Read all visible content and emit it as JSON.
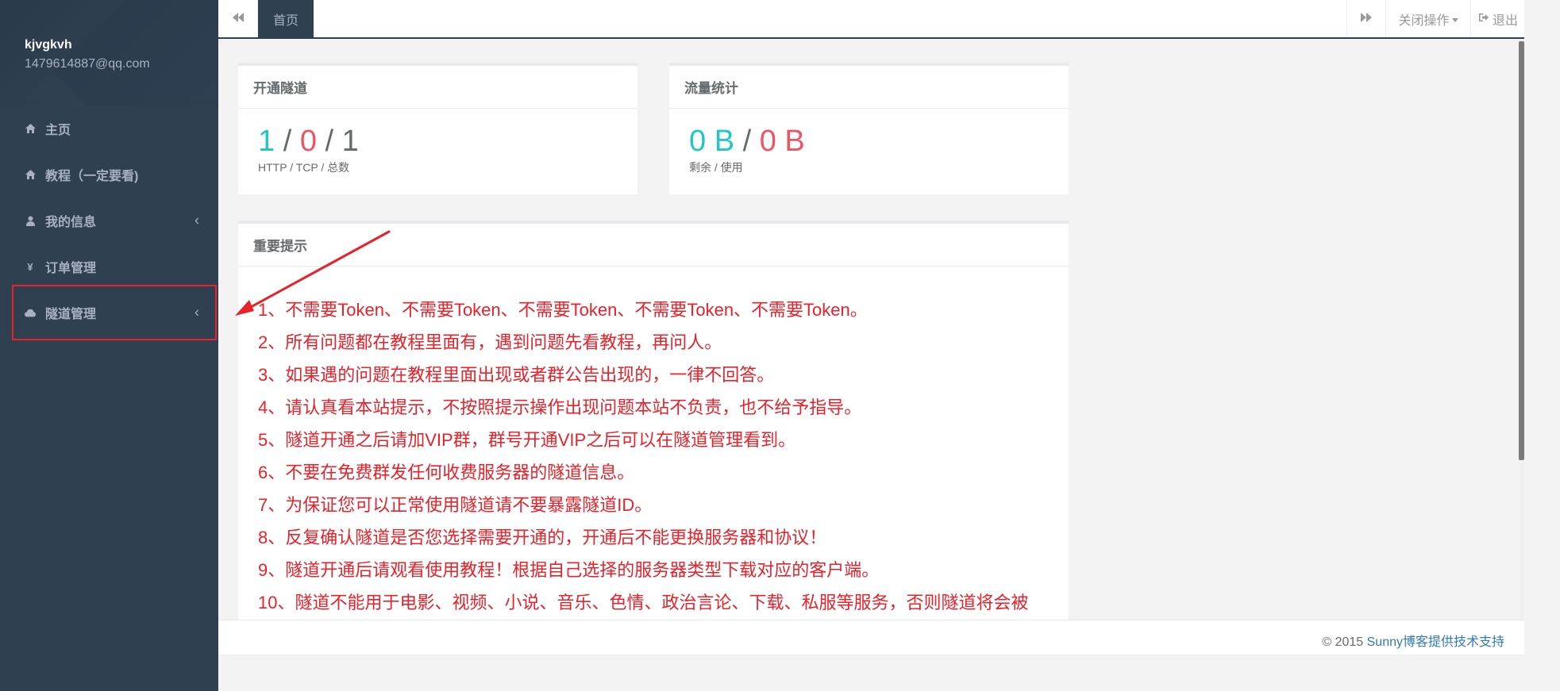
{
  "user": {
    "name": "kjvgkvh",
    "email": "1479614887@qq.com"
  },
  "sidebar": {
    "items": [
      {
        "label": "主页",
        "icon": "home-icon"
      },
      {
        "label": "教程（一定要看)",
        "icon": "home-icon"
      },
      {
        "label": "我的信息",
        "icon": "user-icon",
        "chevron": "‹"
      },
      {
        "label": "订单管理",
        "icon": "yen-icon"
      },
      {
        "label": "隧道管理",
        "icon": "cloud-icon",
        "chevron": "‹"
      }
    ]
  },
  "topbar": {
    "tab_home": "首页",
    "close_ops": "关闭操作",
    "logout": "退出"
  },
  "panels": {
    "tunnels": {
      "title": "开通隧道",
      "http": "1",
      "tcp": "0",
      "total": "1",
      "sep": "/",
      "subtitle": "HTTP / TCP / 总数"
    },
    "traffic": {
      "title": "流量统计",
      "remaining": "0 B",
      "used": "0 B",
      "sep": "/",
      "subtitle": "剩余 / 使用"
    },
    "notice": {
      "title": "重要提示",
      "lines": [
        "1、不需要Token、不需要Token、不需要Token、不需要Token、不需要Token。",
        "2、所有问题都在教程里面有，遇到问题先看教程，再问人。",
        "3、如果遇的问题在教程里面出现或者群公告出现的，一律不回答。",
        "4、请认真看本站提示，不按照提示操作出现问题本站不负责，也不给予指导。",
        "5、隧道开通之后请加VIP群，群号开通VIP之后可以在隧道管理看到。",
        "6、不要在免费群发任何收费服务器的隧道信息。",
        "7、为保证您可以正常使用隧道请不要暴露隧道ID。",
        "8、反复确认隧道是否您选择需要开通的，开通后不能更换服务器和协议！",
        "9、隧道开通后请观看使用教程！根据自己选择的服务器类型下载对应的客户端。",
        "10、隧道不能用于电影、视频、小说、音乐、色情、政治言论、下载、私服等服务，否则隧道将会被"
      ]
    }
  },
  "footer": {
    "copyright": "© 2015 ",
    "link": "Sunny博客提供技术支持"
  },
  "colors": {
    "sidebar": "#2f4050",
    "teal": "#23c6c8",
    "red": "#ed5565",
    "notice_red": "#e8212a",
    "link": "#337ab7"
  }
}
